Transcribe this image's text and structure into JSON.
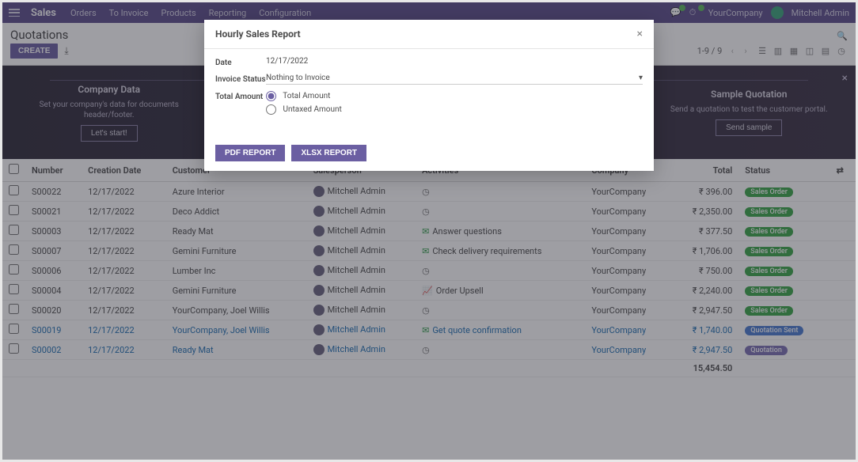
{
  "nav": {
    "brand": "Sales",
    "menu": [
      "Orders",
      "To Invoice",
      "Products",
      "Reporting",
      "Configuration"
    ],
    "company": "YourCompany",
    "user": "Mitchell Admin"
  },
  "page": {
    "title": "Quotations",
    "create_btn": "CREATE",
    "pager": "1-9 / 9"
  },
  "onboard": [
    {
      "title": "Company Data",
      "desc": "Set your company's data for documents header/footer.",
      "btn": "Let's start!"
    },
    {
      "title": "Sample Quotation",
      "desc": "Send a quotation to test the customer portal.",
      "btn": "Send sample"
    }
  ],
  "table": {
    "cols": [
      "Number",
      "Creation Date",
      "Customer",
      "Salesperson",
      "Activities",
      "Company",
      "Total",
      "Status"
    ],
    "footer_total": "15,454.50",
    "rows": [
      {
        "num": "S00022",
        "date": "12/17/2022",
        "customer": "Azure Interior",
        "sales": "Mitchell Admin",
        "activity_icon": "clock",
        "activity": "",
        "company": "YourCompany",
        "total": "₹ 396.00",
        "status": "Sales Order",
        "pill": "green",
        "link": false
      },
      {
        "num": "S00021",
        "date": "12/17/2022",
        "customer": "Deco Addict",
        "sales": "Mitchell Admin",
        "activity_icon": "clock",
        "activity": "",
        "company": "YourCompany",
        "total": "₹ 2,350.00",
        "status": "Sales Order",
        "pill": "green",
        "link": false
      },
      {
        "num": "S00003",
        "date": "12/17/2022",
        "customer": "Ready Mat",
        "sales": "Mitchell Admin",
        "activity_icon": "mail",
        "activity": "Answer questions",
        "company": "YourCompany",
        "total": "₹ 377.50",
        "status": "Sales Order",
        "pill": "green",
        "link": false
      },
      {
        "num": "S00007",
        "date": "12/17/2022",
        "customer": "Gemini Furniture",
        "sales": "Mitchell Admin",
        "activity_icon": "mail",
        "activity": "Check delivery requirements",
        "company": "YourCompany",
        "total": "₹ 1,706.00",
        "status": "Sales Order",
        "pill": "green",
        "link": false
      },
      {
        "num": "S00006",
        "date": "12/17/2022",
        "customer": "Lumber Inc",
        "sales": "Mitchell Admin",
        "activity_icon": "clock",
        "activity": "",
        "company": "YourCompany",
        "total": "₹ 750.00",
        "status": "Sales Order",
        "pill": "green",
        "link": false
      },
      {
        "num": "S00004",
        "date": "12/17/2022",
        "customer": "Gemini Furniture",
        "sales": "Mitchell Admin",
        "activity_icon": "chart",
        "activity": "Order Upsell",
        "company": "YourCompany",
        "total": "₹ 2,240.00",
        "status": "Sales Order",
        "pill": "green",
        "link": false
      },
      {
        "num": "S00020",
        "date": "12/17/2022",
        "customer": "YourCompany, Joel Willis",
        "sales": "Mitchell Admin",
        "activity_icon": "clock",
        "activity": "",
        "company": "YourCompany",
        "total": "₹ 2,947.50",
        "status": "Sales Order",
        "pill": "green",
        "link": false
      },
      {
        "num": "S00019",
        "date": "12/17/2022",
        "customer": "YourCompany, Joel Willis",
        "sales": "Mitchell Admin",
        "activity_icon": "mail",
        "activity": "Get quote confirmation",
        "company": "YourCompany",
        "total": "₹ 1,740.00",
        "status": "Quotation Sent",
        "pill": "blue",
        "link": true
      },
      {
        "num": "S00002",
        "date": "12/17/2022",
        "customer": "Ready Mat",
        "sales": "Mitchell Admin",
        "activity_icon": "clock",
        "activity": "",
        "company": "YourCompany",
        "total": "₹ 2,947.50",
        "status": "Quotation",
        "pill": "purple",
        "link": true
      }
    ]
  },
  "modal": {
    "title": "Hourly Sales Report",
    "fields": {
      "date": {
        "label": "Date",
        "value": "12/17/2022"
      },
      "invoice_status": {
        "label": "Invoice Status",
        "value": "Nothing to Invoice"
      },
      "total_amount": {
        "label": "Total Amount",
        "options": [
          "Total Amount",
          "Untaxed Amount"
        ]
      }
    },
    "buttons": [
      "PDF REPORT",
      "XLSX REPORT"
    ]
  }
}
